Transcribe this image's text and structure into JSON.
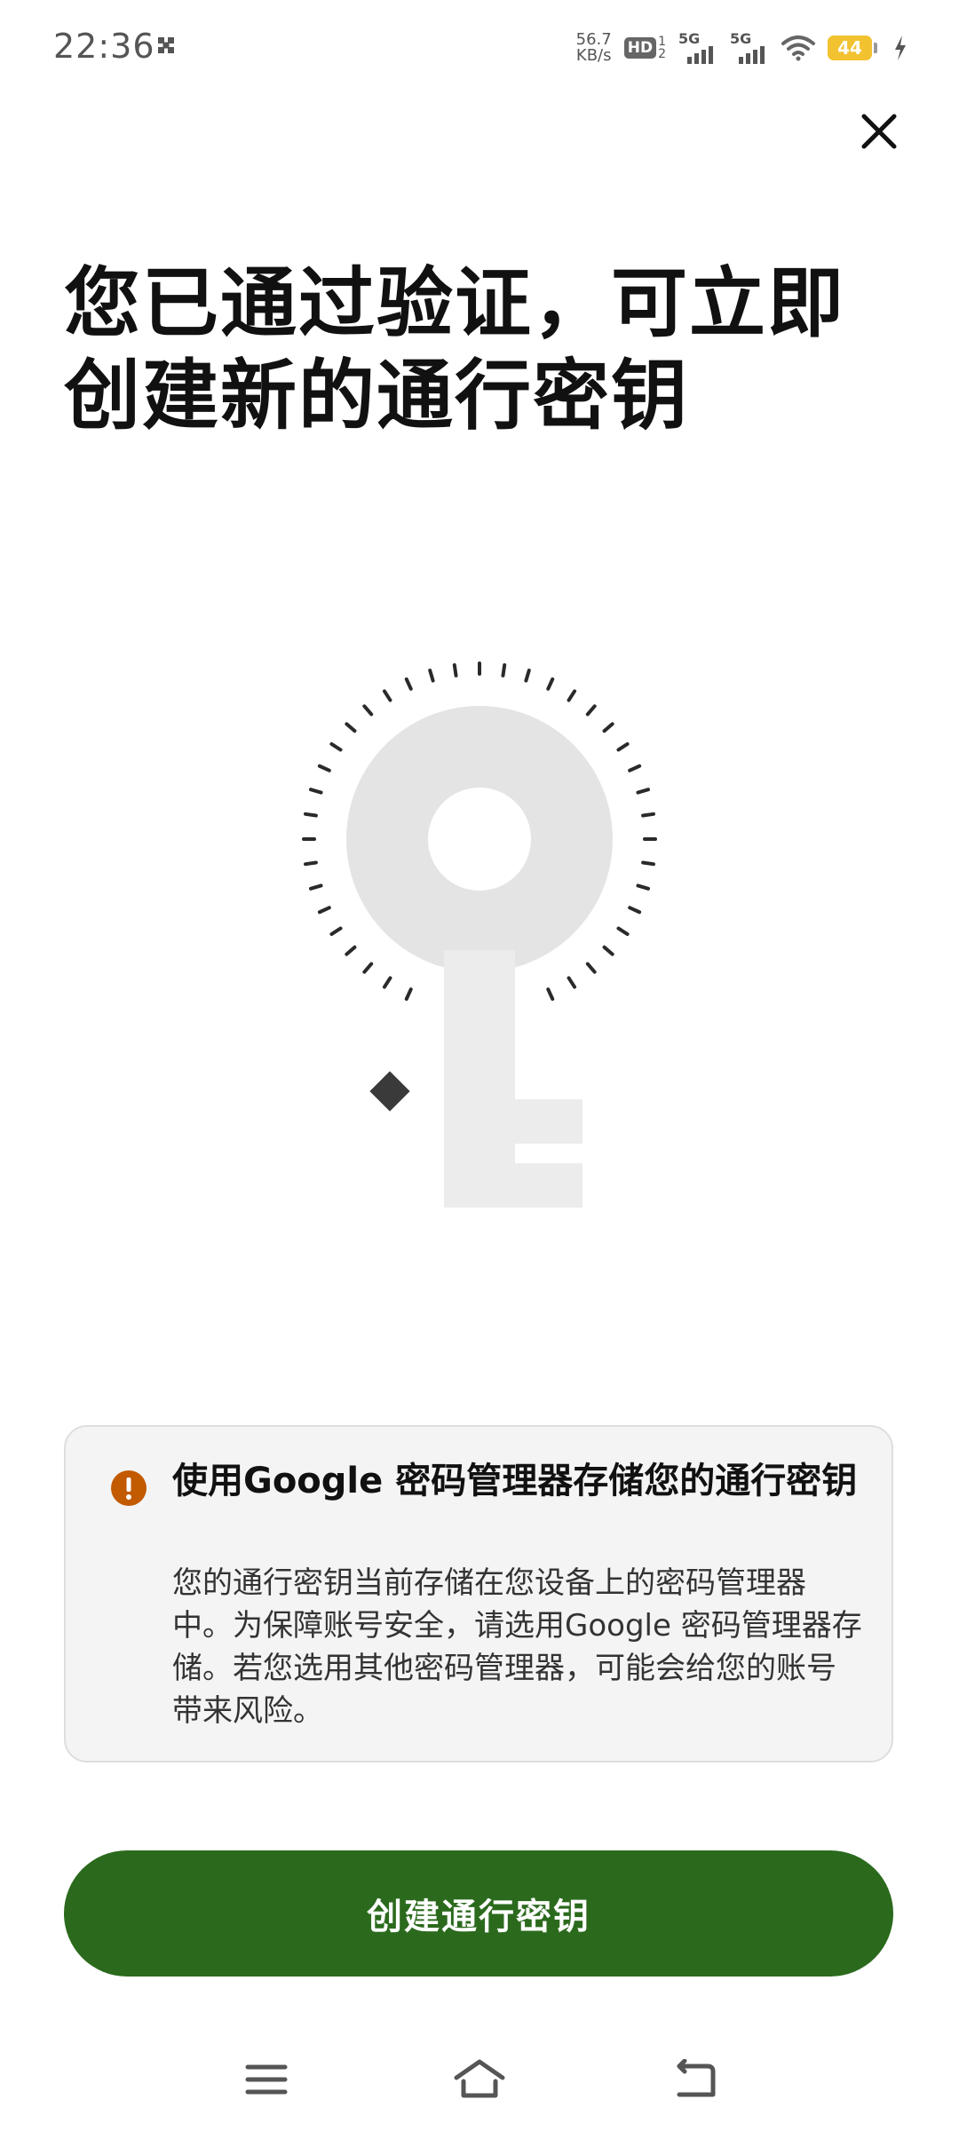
{
  "status_bar": {
    "time": "22:36",
    "net_speed_value": "56.7",
    "net_speed_unit": "KB/s",
    "hd_label": "HD",
    "hd_sub_top": "1",
    "hd_sub_bottom": "2",
    "sim1_label": "5G",
    "sim2_label": "5G",
    "battery_level": "44",
    "icons": [
      "notification-icon",
      "hd-icon",
      "signal-icon",
      "signal-icon",
      "wifi-icon",
      "battery-icon",
      "charging-icon"
    ]
  },
  "header": {
    "close_icon": "close-icon"
  },
  "title": "您已通过验证，可立即创建新的通行密钥",
  "illustration": {
    "icon": "key-icon"
  },
  "warning": {
    "icon": "exclamation-icon",
    "icon_color": "#c25a00",
    "title": "使用Google 密码管理器存储您的通行密钥",
    "body": "您的通行密钥当前存储在您设备上的密码管理器中。为保障账号安全，请选用Google 密码管理器存储。若您选用其他密码管理器，可能会给您的账号带来风险。"
  },
  "primary_action": {
    "label": "创建通行密钥",
    "color": "#2b6a1d"
  },
  "nav_bar": {
    "icons": [
      "menu-icon",
      "home-icon",
      "back-icon"
    ]
  }
}
